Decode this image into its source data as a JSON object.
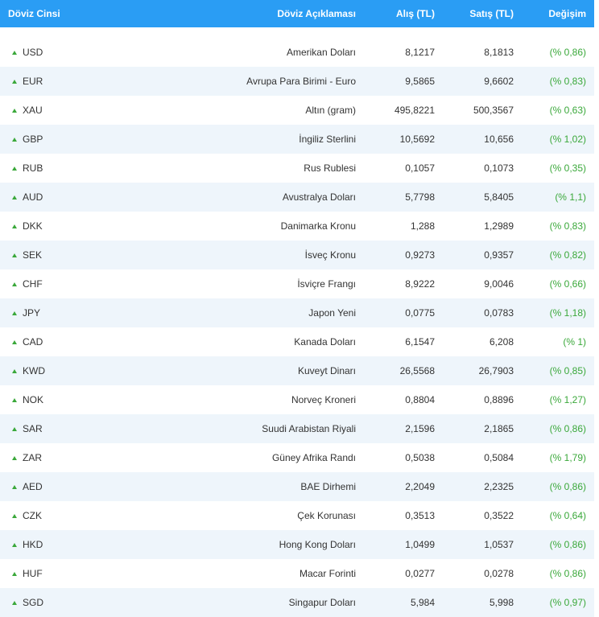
{
  "header": {
    "code": "Döviz Cinsi",
    "description": "Döviz Açıklaması",
    "buy": "Alış (TL)",
    "sell": "Satış (TL)",
    "change": "Değişim"
  },
  "colors": {
    "header_bg": "#2a9df4",
    "alt_row_bg": "#eef5fb",
    "up_green": "#3aa83a"
  },
  "rows": [
    {
      "trend": "up-arrow-icon",
      "code": "USD",
      "name": "Amerikan Doları",
      "buy": "8,1217",
      "sell": "8,1813",
      "change": "(% 0,86)"
    },
    {
      "trend": "up-arrow-icon",
      "code": "EUR",
      "name": "Avrupa Para Birimi - Euro",
      "buy": "9,5865",
      "sell": "9,6602",
      "change": "(% 0,83)"
    },
    {
      "trend": "up-arrow-icon",
      "code": "XAU",
      "name": "Altın (gram)",
      "buy": "495,8221",
      "sell": "500,3567",
      "change": "(% 0,63)"
    },
    {
      "trend": "up-arrow-icon",
      "code": "GBP",
      "name": "İngiliz Sterlini",
      "buy": "10,5692",
      "sell": "10,656",
      "change": "(% 1,02)"
    },
    {
      "trend": "up-arrow-icon",
      "code": "RUB",
      "name": "Rus Rublesi",
      "buy": "0,1057",
      "sell": "0,1073",
      "change": "(% 0,35)"
    },
    {
      "trend": "up-arrow-icon",
      "code": "AUD",
      "name": "Avustralya Doları",
      "buy": "5,7798",
      "sell": "5,8405",
      "change": "(% 1,1)"
    },
    {
      "trend": "up-arrow-icon",
      "code": "DKK",
      "name": "Danimarka Kronu",
      "buy": "1,288",
      "sell": "1,2989",
      "change": "(% 0,83)"
    },
    {
      "trend": "up-arrow-icon",
      "code": "SEK",
      "name": "İsveç Kronu",
      "buy": "0,9273",
      "sell": "0,9357",
      "change": "(% 0,82)"
    },
    {
      "trend": "up-arrow-icon",
      "code": "CHF",
      "name": "İsviçre Frangı",
      "buy": "8,9222",
      "sell": "9,0046",
      "change": "(% 0,66)"
    },
    {
      "trend": "up-arrow-icon",
      "code": "JPY",
      "name": "Japon Yeni",
      "buy": "0,0775",
      "sell": "0,0783",
      "change": "(% 1,18)"
    },
    {
      "trend": "up-arrow-icon",
      "code": "CAD",
      "name": "Kanada Doları",
      "buy": "6,1547",
      "sell": "6,208",
      "change": "(% 1)"
    },
    {
      "trend": "up-arrow-icon",
      "code": "KWD",
      "name": "Kuveyt Dinarı",
      "buy": "26,5568",
      "sell": "26,7903",
      "change": "(% 0,85)"
    },
    {
      "trend": "up-arrow-icon",
      "code": "NOK",
      "name": "Norveç Kroneri",
      "buy": "0,8804",
      "sell": "0,8896",
      "change": "(% 1,27)"
    },
    {
      "trend": "up-arrow-icon",
      "code": "SAR",
      "name": "Suudi Arabistan Riyali",
      "buy": "2,1596",
      "sell": "2,1865",
      "change": "(% 0,86)"
    },
    {
      "trend": "up-arrow-icon",
      "code": "ZAR",
      "name": "Güney Afrika Randı",
      "buy": "0,5038",
      "sell": "0,5084",
      "change": "(% 1,79)"
    },
    {
      "trend": "up-arrow-icon",
      "code": "AED",
      "name": "BAE Dirhemi",
      "buy": "2,2049",
      "sell": "2,2325",
      "change": "(% 0,86)"
    },
    {
      "trend": "up-arrow-icon",
      "code": "CZK",
      "name": "Çek Korunası",
      "buy": "0,3513",
      "sell": "0,3522",
      "change": "(% 0,64)"
    },
    {
      "trend": "up-arrow-icon",
      "code": "HKD",
      "name": "Hong Kong Doları",
      "buy": "1,0499",
      "sell": "1,0537",
      "change": "(% 0,86)"
    },
    {
      "trend": "up-arrow-icon",
      "code": "HUF",
      "name": "Macar Forinti",
      "buy": "0,0277",
      "sell": "0,0278",
      "change": "(% 0,86)"
    },
    {
      "trend": "up-arrow-icon",
      "code": "SGD",
      "name": "Singapur Doları",
      "buy": "5,984",
      "sell": "5,998",
      "change": "(% 0,97)"
    }
  ]
}
